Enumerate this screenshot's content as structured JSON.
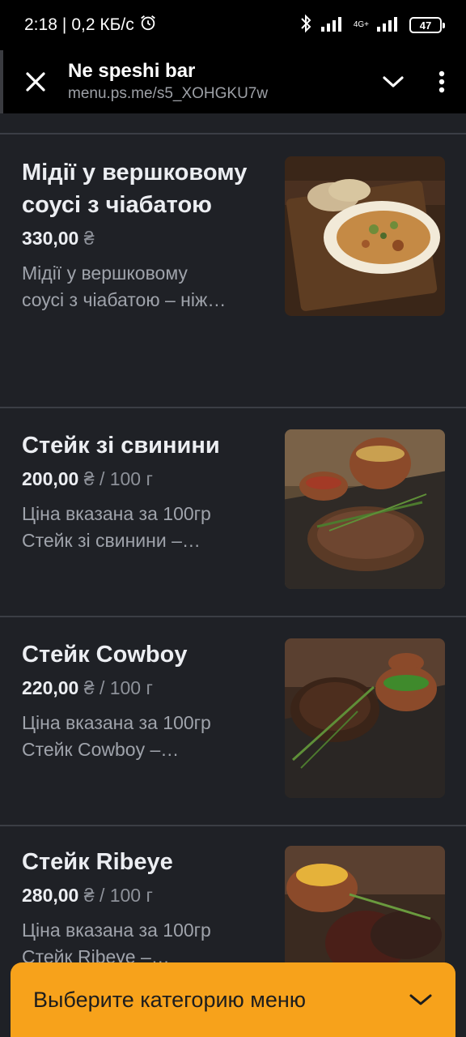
{
  "status_bar": {
    "time": "2:18",
    "network_speed": "0,2 КБ/с",
    "network_type": "4G+",
    "battery": "47"
  },
  "browser": {
    "title": "Ne speshi bar",
    "url": "menu.ps.me/s5_XOHGKU7w"
  },
  "items": [
    {
      "name": "Мідії у вершковому соусі з чіабатою",
      "price": "330,00",
      "currency": "₴",
      "unit": "",
      "desc_line1": "Мідії у вершковому",
      "desc_line2": "соусі з чіабатою – ніж…",
      "image": "mussels-dish-photo"
    },
    {
      "name": "Стейк зі свинини",
      "price": "200,00",
      "currency": "₴",
      "unit": "/ 100 г",
      "desc_line1": "Ціна вказана за 100гр",
      "desc_line2": "Стейк зі свинини –…",
      "image": "pork-steak-photo"
    },
    {
      "name": "Стейк Cowboy",
      "price": "220,00",
      "currency": "₴",
      "unit": "/ 100 г",
      "desc_line1": "Ціна вказана за 100гр",
      "desc_line2": "Стейк Cowboy –…",
      "image": "cowboy-steak-photo"
    },
    {
      "name": "Стейк Ribeye",
      "price": "280,00",
      "currency": "₴",
      "unit": "/ 100 г",
      "desc_line1": "Ціна вказана за 100гр",
      "desc_line2": "Стейк Ribeye –…",
      "image": "ribeye-steak-photo"
    }
  ],
  "category_button": {
    "label": "Выберите категорию меню"
  },
  "colors": {
    "background": "#1f2126",
    "accent": "#f7a21b"
  }
}
